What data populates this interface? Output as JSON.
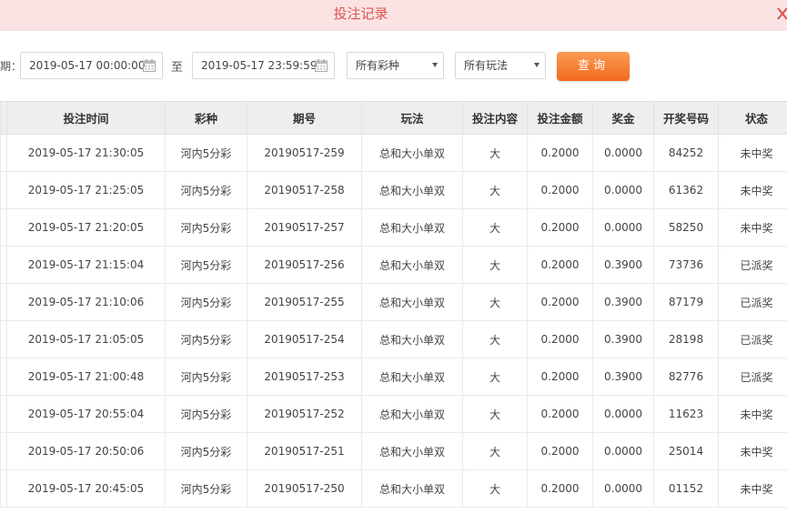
{
  "header": {
    "title": "投注记录",
    "close_icon": "close-icon"
  },
  "filters": {
    "date_prefix": "期：",
    "start_date": "2019-05-17 00:00:00",
    "to_label": "至",
    "end_date": "2019-05-17 23:59:59",
    "lottery_select": "所有彩种",
    "play_select": "所有玩法",
    "query_button": "查询"
  },
  "colors": {
    "header_bg": "#fbe3e3",
    "title": "#d9534f",
    "button_top": "#fb9b55",
    "button_bottom": "#f26a1e",
    "won_status": "#d9332e",
    "lost_status": "#9a9a9a"
  },
  "table": {
    "columns": [
      "投注时间",
      "彩种",
      "期号",
      "玩法",
      "投注内容",
      "投注金额",
      "奖金",
      "开奖号码",
      "状态"
    ],
    "rows": [
      {
        "time": "2019-05-17 21:30:05",
        "lottery": "河内5分彩",
        "issue": "20190517-259",
        "play": "总和大小单双",
        "content": "大",
        "amount": "0.2000",
        "prize": "0.0000",
        "numbers": "84252",
        "status": "未中奖",
        "won": false
      },
      {
        "time": "2019-05-17 21:25:05",
        "lottery": "河内5分彩",
        "issue": "20190517-258",
        "play": "总和大小单双",
        "content": "大",
        "amount": "0.2000",
        "prize": "0.0000",
        "numbers": "61362",
        "status": "未中奖",
        "won": false
      },
      {
        "time": "2019-05-17 21:20:05",
        "lottery": "河内5分彩",
        "issue": "20190517-257",
        "play": "总和大小单双",
        "content": "大",
        "amount": "0.2000",
        "prize": "0.0000",
        "numbers": "58250",
        "status": "未中奖",
        "won": false
      },
      {
        "time": "2019-05-17 21:15:04",
        "lottery": "河内5分彩",
        "issue": "20190517-256",
        "play": "总和大小单双",
        "content": "大",
        "amount": "0.2000",
        "prize": "0.3900",
        "numbers": "73736",
        "status": "已派奖",
        "won": true
      },
      {
        "time": "2019-05-17 21:10:06",
        "lottery": "河内5分彩",
        "issue": "20190517-255",
        "play": "总和大小单双",
        "content": "大",
        "amount": "0.2000",
        "prize": "0.3900",
        "numbers": "87179",
        "status": "已派奖",
        "won": true
      },
      {
        "time": "2019-05-17 21:05:05",
        "lottery": "河内5分彩",
        "issue": "20190517-254",
        "play": "总和大小单双",
        "content": "大",
        "amount": "0.2000",
        "prize": "0.3900",
        "numbers": "28198",
        "status": "已派奖",
        "won": true
      },
      {
        "time": "2019-05-17 21:00:48",
        "lottery": "河内5分彩",
        "issue": "20190517-253",
        "play": "总和大小单双",
        "content": "大",
        "amount": "0.2000",
        "prize": "0.3900",
        "numbers": "82776",
        "status": "已派奖",
        "won": true
      },
      {
        "time": "2019-05-17 20:55:04",
        "lottery": "河内5分彩",
        "issue": "20190517-252",
        "play": "总和大小单双",
        "content": "大",
        "amount": "0.2000",
        "prize": "0.0000",
        "numbers": "11623",
        "status": "未中奖",
        "won": false
      },
      {
        "time": "2019-05-17 20:50:06",
        "lottery": "河内5分彩",
        "issue": "20190517-251",
        "play": "总和大小单双",
        "content": "大",
        "amount": "0.2000",
        "prize": "0.0000",
        "numbers": "25014",
        "status": "未中奖",
        "won": false
      },
      {
        "time": "2019-05-17 20:45:05",
        "lottery": "河内5分彩",
        "issue": "20190517-250",
        "play": "总和大小单双",
        "content": "大",
        "amount": "0.2000",
        "prize": "0.0000",
        "numbers": "01152",
        "status": "未中奖",
        "won": false
      }
    ]
  }
}
